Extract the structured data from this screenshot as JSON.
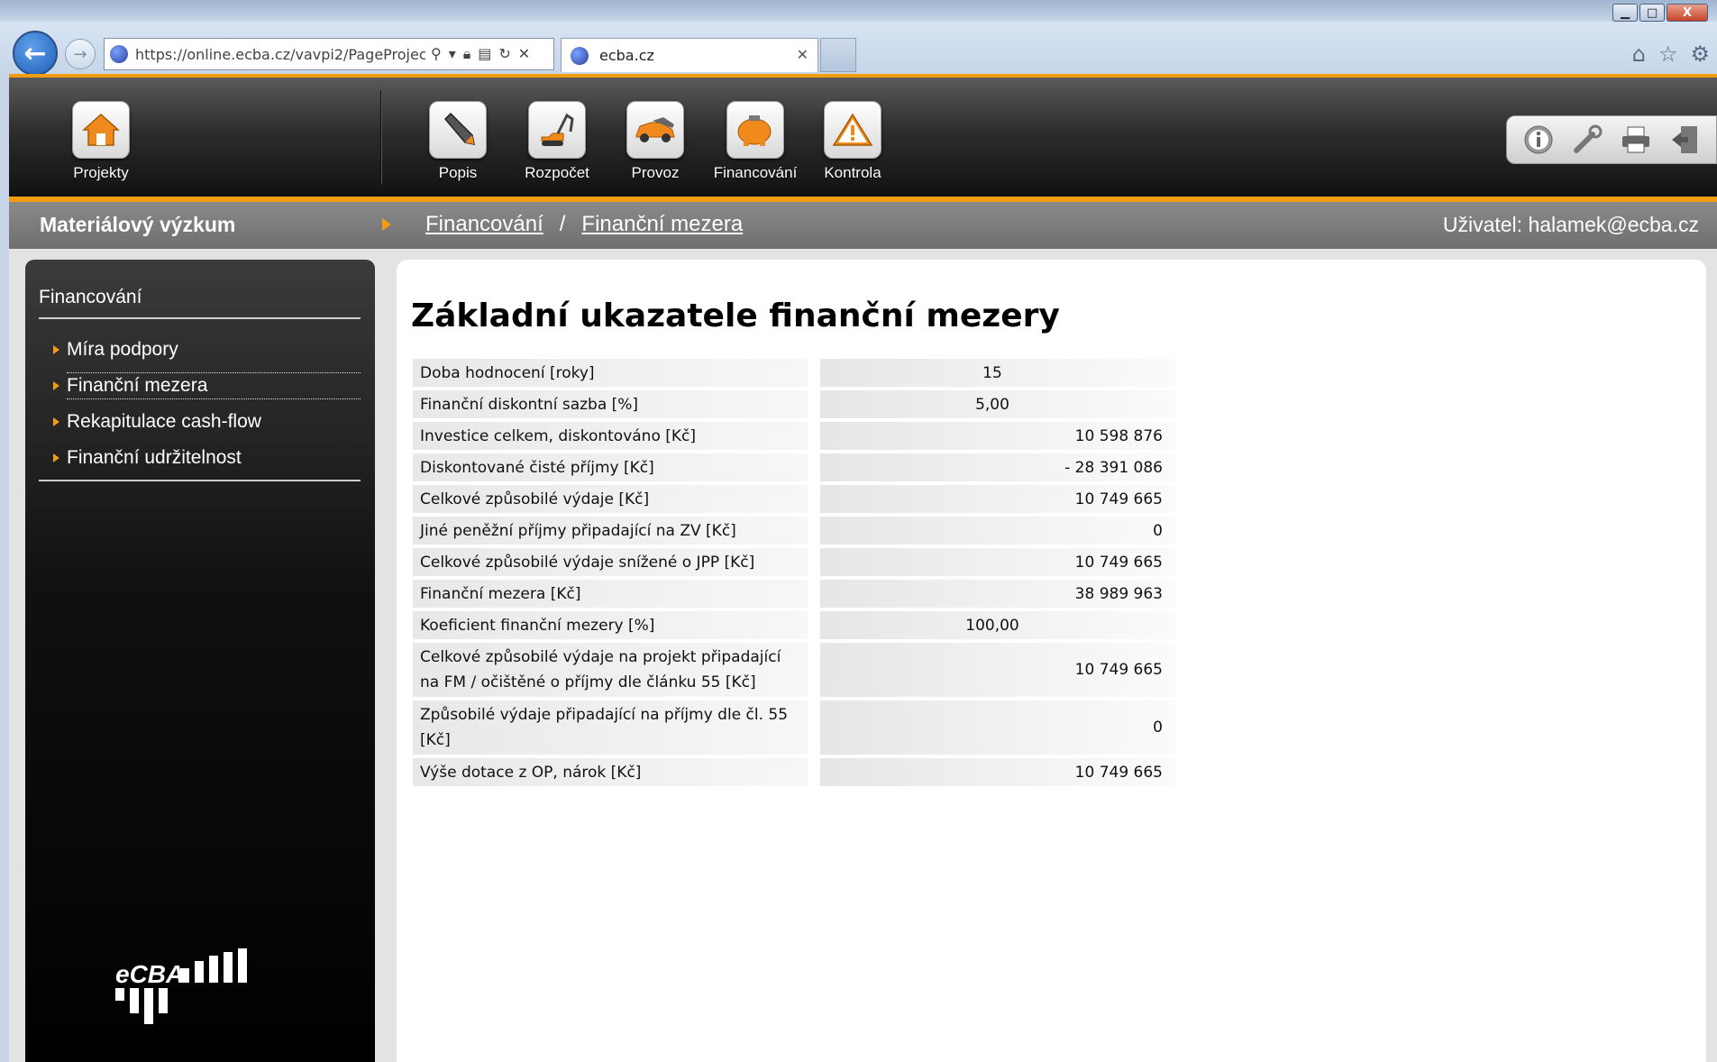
{
  "browser": {
    "url": "https://online.ecba.cz/vavpi2/PageProjec",
    "tab_title": "ecba.cz",
    "window_buttons": {
      "minimize": "▁",
      "maximize": "□",
      "close": "X"
    }
  },
  "toolbar": {
    "items": [
      {
        "label": "Projekty",
        "icon": "home-icon"
      },
      {
        "label": "Popis",
        "icon": "pencil-icon"
      },
      {
        "label": "Rozpočet",
        "icon": "excavator-icon"
      },
      {
        "label": "Provoz",
        "icon": "car-icon"
      },
      {
        "label": "Financování",
        "icon": "piggy-bank-icon"
      },
      {
        "label": "Kontrola",
        "icon": "warning-icon"
      }
    ],
    "right_tools": [
      "info-icon",
      "tools-icon",
      "print-icon",
      "exit-icon"
    ],
    "accent": "#f39c12"
  },
  "breadcrumb": {
    "project": "Materiálový výzkum",
    "section": "Financování",
    "separator": "/",
    "page": "Finanční mezera",
    "user": "Uživatel: halamek@ecba.cz"
  },
  "sidebar": {
    "title": "Financování",
    "items": [
      {
        "label": "Míra podpory"
      },
      {
        "label": "Finanční mezera"
      },
      {
        "label": "Rekapitulace cash-flow"
      },
      {
        "label": "Finanční udržitelnost"
      }
    ],
    "logo_text": "eCBA"
  },
  "main": {
    "title": "Základní ukazatele finanční mezery",
    "rows": [
      {
        "label": "Doba hodnocení [roky]",
        "value": "15"
      },
      {
        "label": "Finanční diskontní sazba [%]",
        "value": "5,00"
      },
      {
        "label": "Investice celkem, diskontováno [Kč]",
        "value": "10 598 876"
      },
      {
        "label": "Diskontované čisté příjmy [Kč]",
        "value": "- 28 391 086"
      },
      {
        "label": "Celkové způsobilé výdaje [Kč]",
        "value": "10 749 665"
      },
      {
        "label": "Jiné peněžní příjmy připadající na ZV [Kč]",
        "value": "0"
      },
      {
        "label": "Celkové způsobilé výdaje snížené o JPP [Kč]",
        "value": "10 749 665"
      },
      {
        "label": "Finanční mezera [Kč]",
        "value": "38 989 963"
      },
      {
        "label": "Koeficient finanční mezery [%]",
        "value": "100,00"
      },
      {
        "label": "Celkové způsobilé výdaje na projekt připadající na FM / očištěné o příjmy dle článku 55 [Kč]",
        "value": "10 749 665"
      },
      {
        "label": "Způsobilé výdaje připadající na příjmy dle čl. 55 [Kč]",
        "value": "0"
      },
      {
        "label": "Výše dotace z OP, nárok [Kč]",
        "value": "10 749 665"
      }
    ]
  }
}
